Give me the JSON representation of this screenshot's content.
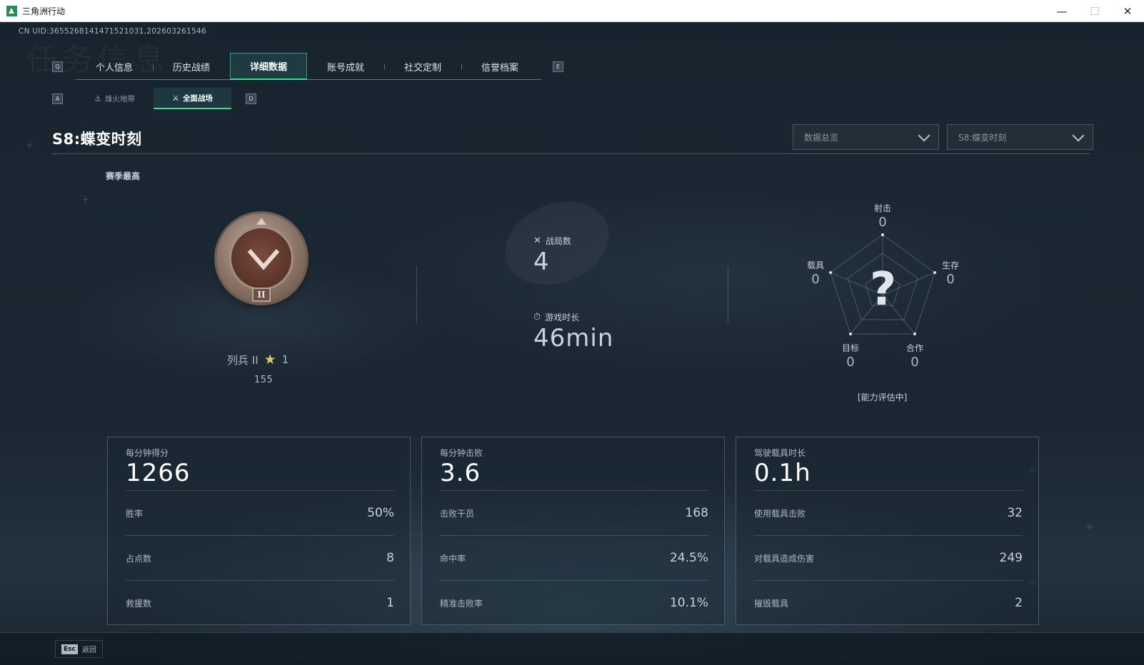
{
  "window": {
    "title": "三角洲行动",
    "minimize": "—",
    "maximize": "☐",
    "close": "✕"
  },
  "uid": "CN UID:3655268141471521031,202603261546",
  "background_ghost": "任务信息",
  "tabs": {
    "prev_key": "Q",
    "next_key": "E",
    "items": [
      {
        "label": "个人信息",
        "active": false
      },
      {
        "label": "历史战绩",
        "active": false
      },
      {
        "label": "详细数据",
        "active": true
      },
      {
        "label": "账号成就",
        "active": false
      },
      {
        "label": "社交定制",
        "active": false
      },
      {
        "label": "信誉档案",
        "active": false
      }
    ]
  },
  "subtabs": {
    "prev_key": "A",
    "next_key": "D",
    "items": [
      {
        "label": "烽火地带",
        "icon": "flame-zone-icon",
        "active": false
      },
      {
        "label": "全面战场",
        "icon": "warfare-icon",
        "active": true
      }
    ]
  },
  "season": {
    "title": "S8:蝶变时刻",
    "dropdown_scope": "数据总览",
    "dropdown_season": "S8:蝶变时刻"
  },
  "rank": {
    "section_label": "赛季最高",
    "badge_numeral": "II",
    "name": "列兵 II",
    "stars": "1",
    "points": "155"
  },
  "summary": {
    "matches_label": "战局数",
    "matches_value": "4",
    "playtime_label": "游戏时长",
    "playtime_value": "46min"
  },
  "radar": {
    "axes": [
      {
        "label": "射击",
        "value": "0"
      },
      {
        "label": "生存",
        "value": "0"
      },
      {
        "label": "合作",
        "value": "0"
      },
      {
        "label": "目标",
        "value": "0"
      },
      {
        "label": "载具",
        "value": "0"
      }
    ],
    "center": "?",
    "note": "[能力评估中]"
  },
  "panels": [
    {
      "title": "每分钟得分",
      "value": "1266",
      "rows": [
        {
          "label": "胜率",
          "value": "50%"
        },
        {
          "label": "占点数",
          "value": "8"
        },
        {
          "label": "救援数",
          "value": "1"
        }
      ]
    },
    {
      "title": "每分钟击败",
      "value": "3.6",
      "rows": [
        {
          "label": "击败干员",
          "value": "168"
        },
        {
          "label": "命中率",
          "value": "24.5%"
        },
        {
          "label": "精准击败率",
          "value": "10.1%"
        }
      ]
    },
    {
      "title": "驾驶载具时长",
      "value": "0.1h",
      "rows": [
        {
          "label": "使用载具击败",
          "value": "32"
        },
        {
          "label": "对载具造成伤害",
          "value": "249"
        },
        {
          "label": "摧毁载具",
          "value": "2"
        }
      ]
    }
  ],
  "footer": {
    "esc_key": "Esc",
    "back_label": "返回"
  },
  "colors": {
    "accent": "#35e08a",
    "background": "#17232d",
    "text": "#c9d2da"
  }
}
